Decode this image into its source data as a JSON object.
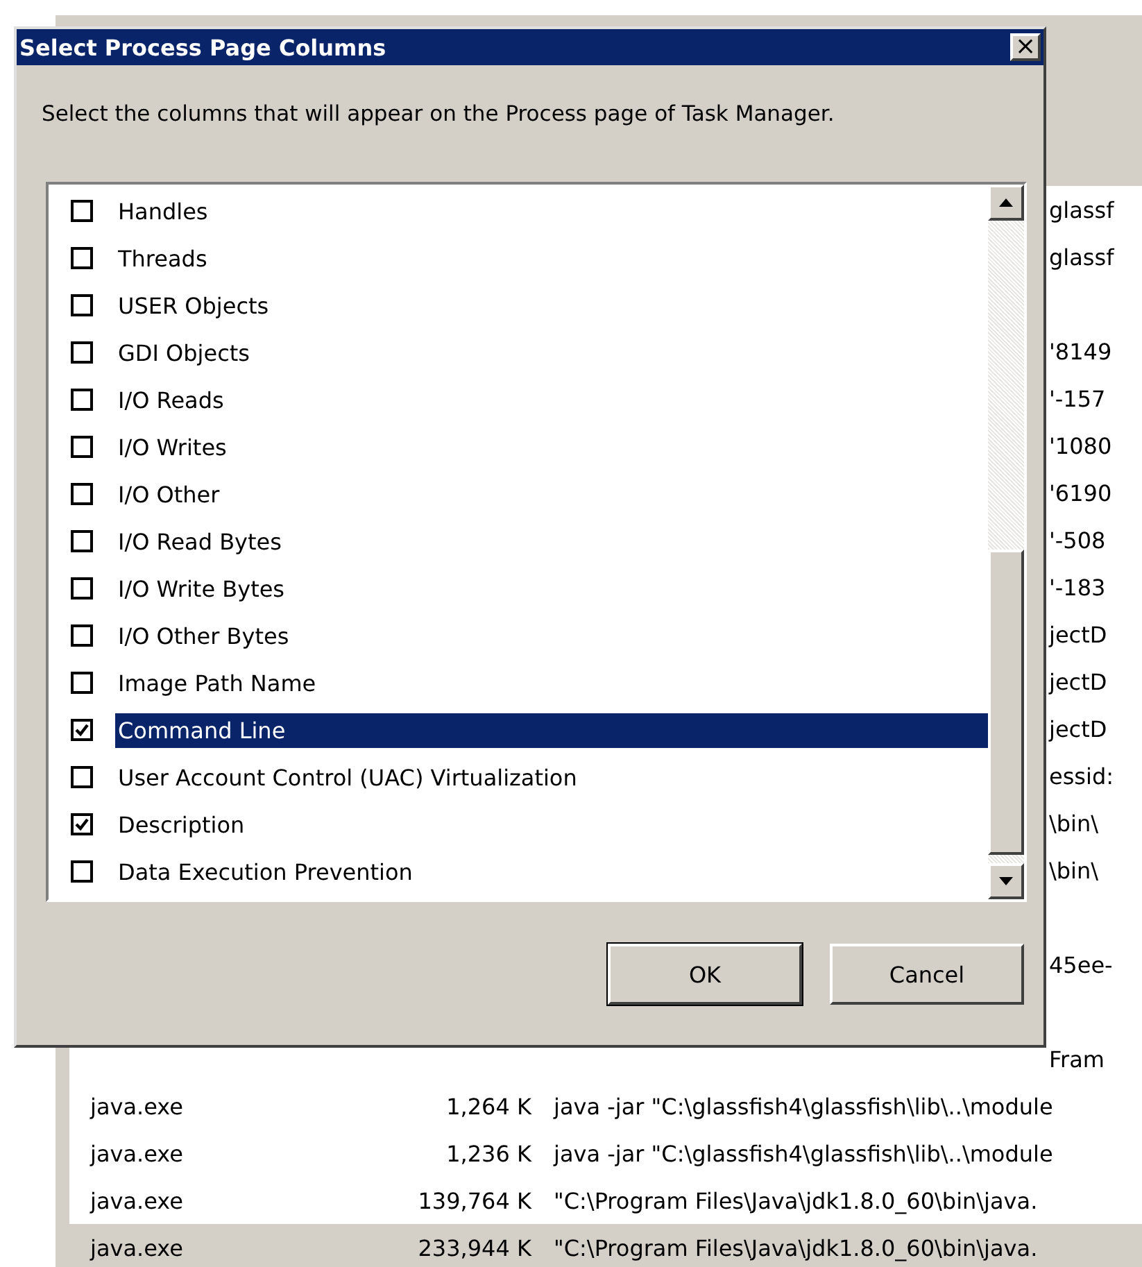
{
  "background_window": {
    "right_column_fragments": [
      {
        "kind": "text",
        "text": "glassf"
      },
      {
        "kind": "text",
        "text": "glassf"
      },
      {
        "kind": "blank"
      },
      {
        "kind": "text",
        "text": "'8149"
      },
      {
        "kind": "text",
        "text": "'-157"
      },
      {
        "kind": "text",
        "text": "'1080"
      },
      {
        "kind": "text",
        "text": "'6190"
      },
      {
        "kind": "text",
        "text": "'-508"
      },
      {
        "kind": "text",
        "text": "'-183"
      },
      {
        "kind": "text",
        "text": "jectD"
      },
      {
        "kind": "text",
        "text": "jectD"
      },
      {
        "kind": "text",
        "text": "jectD"
      },
      {
        "kind": "text",
        "text": "essid:"
      },
      {
        "kind": "text",
        "text": "\\bin\\"
      },
      {
        "kind": "text",
        "text": "\\bin\\"
      },
      {
        "kind": "blank"
      },
      {
        "kind": "text",
        "text": "45ee-"
      },
      {
        "kind": "blank"
      },
      {
        "kind": "text",
        "text": "Fram"
      }
    ],
    "rows": [
      {
        "name": "java.exe",
        "memory": "1,264 K",
        "command_line": "java  -jar \"C:\\glassfish4\\glassfish\\lib\\..\\module",
        "selected": false
      },
      {
        "name": "java.exe",
        "memory": "1,236 K",
        "command_line": "java  -jar \"C:\\glassfish4\\glassfish\\lib\\..\\module",
        "selected": false
      },
      {
        "name": "java.exe",
        "memory": "139,764 K",
        "command_line": "\"C:\\Program Files\\Java\\jdk1.8.0_60\\bin\\java.",
        "selected": false
      },
      {
        "name": "java.exe",
        "memory": "233,944 K",
        "command_line": "\"C:\\Program Files\\Java\\jdk1.8.0_60\\bin\\java.",
        "selected": true
      }
    ]
  },
  "dialog": {
    "title": "Select Process Page Columns",
    "close": "×",
    "description": "Select the columns that will appear on the Process page of Task Manager.",
    "columns": [
      {
        "label": "Handles",
        "checked": false,
        "selected": false
      },
      {
        "label": "Threads",
        "checked": false,
        "selected": false
      },
      {
        "label": "USER Objects",
        "checked": false,
        "selected": false
      },
      {
        "label": "GDI Objects",
        "checked": false,
        "selected": false
      },
      {
        "label": "I/O Reads",
        "checked": false,
        "selected": false
      },
      {
        "label": "I/O Writes",
        "checked": false,
        "selected": false
      },
      {
        "label": "I/O Other",
        "checked": false,
        "selected": false
      },
      {
        "label": "I/O Read Bytes",
        "checked": false,
        "selected": false
      },
      {
        "label": "I/O Write Bytes",
        "checked": false,
        "selected": false
      },
      {
        "label": "I/O Other Bytes",
        "checked": false,
        "selected": false
      },
      {
        "label": "Image Path Name",
        "checked": false,
        "selected": false
      },
      {
        "label": "Command Line",
        "checked": true,
        "selected": true
      },
      {
        "label": "User Account Control (UAC) Virtualization",
        "checked": false,
        "selected": false
      },
      {
        "label": "Description",
        "checked": true,
        "selected": false
      },
      {
        "label": "Data Execution Prevention",
        "checked": false,
        "selected": false
      }
    ],
    "buttons": [
      {
        "label": "OK",
        "default": true
      },
      {
        "label": "Cancel",
        "default": false
      }
    ]
  }
}
